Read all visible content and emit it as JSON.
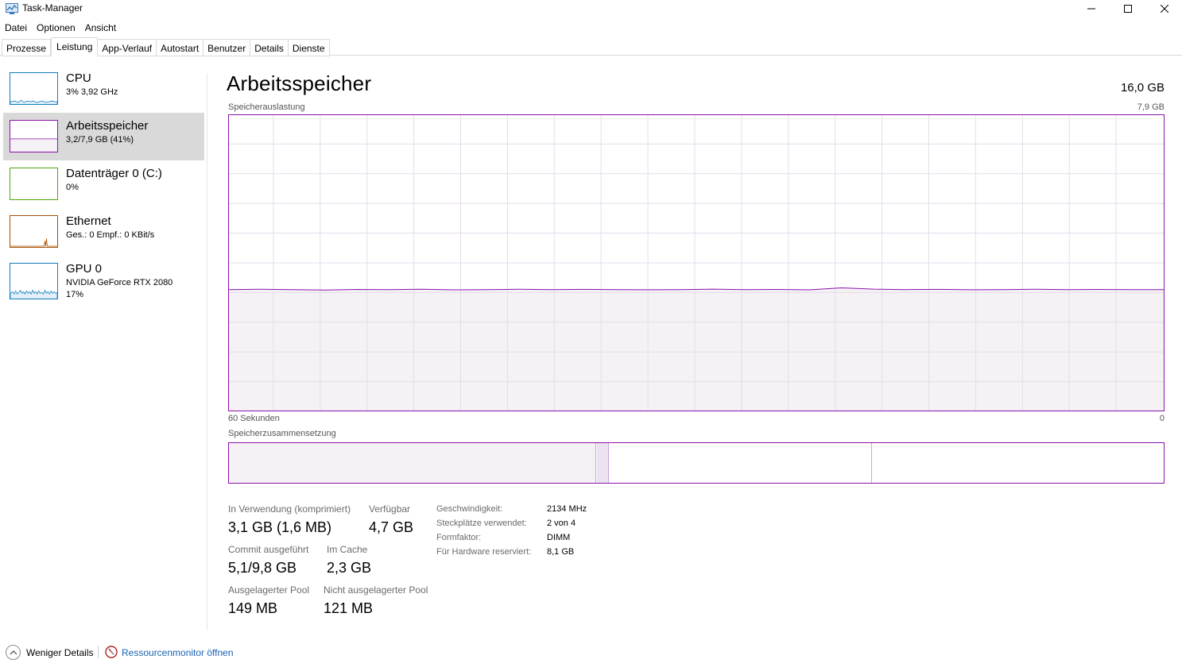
{
  "window": {
    "title": "Task-Manager"
  },
  "menu": [
    "Datei",
    "Optionen",
    "Ansicht"
  ],
  "tabs": [
    "Prozesse",
    "Leistung",
    "App-Verlauf",
    "Autostart",
    "Benutzer",
    "Details",
    "Dienste"
  ],
  "active_tab": "Leistung",
  "sidebar": {
    "items": [
      {
        "title": "CPU",
        "sub1": "3%  3,92 GHz",
        "sub2": "",
        "color": "#117dbb",
        "icon": "cpu-graph-icon"
      },
      {
        "title": "Arbeitsspeicher",
        "sub1": "3,2/7,9 GB (41%)",
        "sub2": "",
        "color": "#8b12ae",
        "icon": "memory-graph-icon"
      },
      {
        "title": "Datenträger 0 (C:)",
        "sub1": "0%",
        "sub2": "",
        "color": "#4da60c",
        "icon": "disk-graph-icon"
      },
      {
        "title": "Ethernet",
        "sub1": "Ges.: 0  Empf.: 0 KBit/s",
        "sub2": "",
        "color": "#a74f01",
        "icon": "ethernet-graph-icon"
      },
      {
        "title": "GPU 0",
        "sub1": "NVIDIA GeForce RTX 2080",
        "sub2": "17%",
        "color": "#117dbb",
        "icon": "gpu-graph-icon"
      }
    ]
  },
  "main": {
    "title": "Arbeitsspeicher",
    "total": "16,0 GB",
    "graph_label": "Speicherauslastung",
    "graph_max": "7,9 GB",
    "graph_time": "60 Sekunden",
    "graph_min": "0",
    "composition_label": "Speicherzusammensetzung",
    "usage_fraction": 0.41,
    "stats": {
      "in_use_label": "In Verwendung (komprimiert)",
      "in_use_value": "3,1 GB (1,6 MB)",
      "available_label": "Verfügbar",
      "available_value": "4,7 GB",
      "committed_label": "Commit ausgeführt",
      "committed_value": "5,1/9,8 GB",
      "cached_label": "Im Cache",
      "cached_value": "2,3 GB",
      "paged_label": "Ausgelagerter Pool",
      "paged_value": "149 MB",
      "nonpaged_label": "Nicht ausgelagerter Pool",
      "nonpaged_value": "121 MB"
    },
    "details": {
      "speed_label": "Geschwindigkeit:",
      "speed_value": "2134 MHz",
      "slots_label": "Steckplätze verwendet:",
      "slots_value": "2 von 4",
      "form_label": "Formfaktor:",
      "form_value": "DIMM",
      "reserved_label": "Für Hardware reserviert:",
      "reserved_value": "8,1 GB"
    }
  },
  "footer": {
    "fewer_details": "Weniger Details",
    "resource_monitor": "Ressourcenmonitor öffnen"
  },
  "colors": {
    "memory": "#8b12ae",
    "memory_fill": "#f4f2f4",
    "grid": "#e6dcec",
    "link": "#1a64b4",
    "selected": "#d9d9d9"
  }
}
